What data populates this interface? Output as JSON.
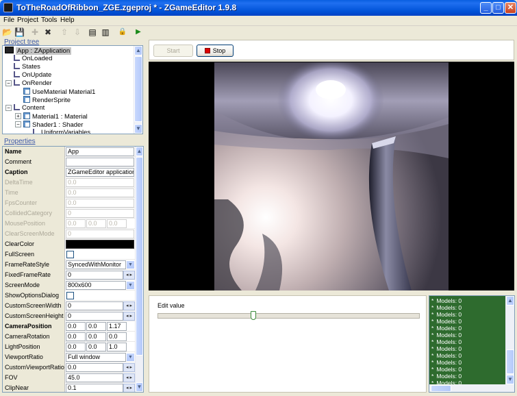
{
  "window": {
    "title": "ToTheRoadOfRibbon_ZGE.zgeproj * - ZGameEditor 1.9.8",
    "minimize": "_",
    "maximize": "□",
    "close": "✕"
  },
  "menu": [
    "File",
    "Project",
    "Tools",
    "Help"
  ],
  "toolbar": [
    {
      "icon": "open-folder-icon",
      "glyph": "📂"
    },
    {
      "icon": "save-icon",
      "glyph": "💾"
    },
    {
      "icon": "add-icon",
      "glyph": "✚"
    },
    {
      "icon": "delete-icon",
      "glyph": "✖"
    },
    {
      "icon": "move-up-icon",
      "glyph": "⇧"
    },
    {
      "icon": "move-down-icon",
      "glyph": "⇩"
    },
    {
      "icon": "copy-icon",
      "glyph": "▤"
    },
    {
      "icon": "paste-icon",
      "glyph": "▥"
    },
    {
      "icon": "lock-icon",
      "glyph": "🔒"
    },
    {
      "icon": "run-icon",
      "glyph": "▶"
    }
  ],
  "project_tree": {
    "label": "Project tree",
    "items": [
      {
        "text": "App : ZApplication",
        "type": "app",
        "selected": true
      },
      {
        "text": "OnLoaded",
        "type": "event"
      },
      {
        "text": "States",
        "type": "event"
      },
      {
        "text": "OnUpdate",
        "type": "event"
      },
      {
        "text": "OnRender",
        "type": "event",
        "expander": "−"
      },
      {
        "text": "UseMaterial  Material1",
        "type": "component"
      },
      {
        "text": "RenderSprite",
        "type": "component"
      },
      {
        "text": "Content",
        "type": "event",
        "expander": "−"
      },
      {
        "text": "Material1 : Material",
        "type": "component",
        "expander": "+"
      },
      {
        "text": "Shader1 : Shader",
        "type": "component",
        "expander": "−"
      },
      {
        "text": "UniformVariables",
        "type": "event"
      }
    ]
  },
  "properties": {
    "label": "Properties",
    "rows": [
      {
        "name": "Name",
        "bold": true,
        "kind": "text",
        "value": "App"
      },
      {
        "name": "Comment",
        "kind": "text",
        "value": ""
      },
      {
        "name": "Caption",
        "bold": true,
        "kind": "text",
        "value": "ZGameEditor application"
      },
      {
        "name": "DeltaTime",
        "disabled": true,
        "kind": "text",
        "value": "0.0"
      },
      {
        "name": "Time",
        "disabled": true,
        "kind": "text",
        "value": "0.0"
      },
      {
        "name": "FpsCounter",
        "disabled": true,
        "kind": "text",
        "value": "0.0"
      },
      {
        "name": "CollidedCategory",
        "disabled": true,
        "kind": "text",
        "value": "0"
      },
      {
        "name": "MousePosition",
        "disabled": true,
        "kind": "vec",
        "values": [
          "0.0",
          "0.0",
          "0.0"
        ]
      },
      {
        "name": "ClearScreenMode",
        "disabled": true,
        "kind": "text",
        "value": "0"
      },
      {
        "name": "ClearColor",
        "kind": "color",
        "value": "#000000"
      },
      {
        "name": "FullScreen",
        "kind": "check",
        "value": ""
      },
      {
        "name": "FrameRateStyle",
        "kind": "select",
        "value": "SyncedWithMonitor"
      },
      {
        "name": "FixedFrameRate",
        "kind": "spin",
        "value": "0"
      },
      {
        "name": "ScreenMode",
        "kind": "select",
        "value": "800x600"
      },
      {
        "name": "ShowOptionsDialog",
        "kind": "check",
        "value": ""
      },
      {
        "name": "CustomScreenWidth",
        "kind": "spin",
        "value": "0"
      },
      {
        "name": "CustomScreenHeight",
        "kind": "spin",
        "value": "0"
      },
      {
        "name": "CameraPosition",
        "bold": true,
        "kind": "vec",
        "values": [
          "0.0",
          "0.0",
          "1.17"
        ]
      },
      {
        "name": "CameraRotation",
        "kind": "vec",
        "values": [
          "0.0",
          "0.0",
          "0.0"
        ]
      },
      {
        "name": "LightPosition",
        "kind": "vec",
        "values": [
          "0.0",
          "0.0",
          "1.0"
        ]
      },
      {
        "name": "ViewportRatio",
        "kind": "select",
        "value": "Full window"
      },
      {
        "name": "CustomViewportRatio",
        "kind": "spin",
        "value": "0.0"
      },
      {
        "name": "FOV",
        "kind": "spin",
        "value": "45.0"
      },
      {
        "name": "ClipNear",
        "kind": "spin",
        "value": "0.1"
      }
    ]
  },
  "preview": {
    "start_label": "Start",
    "stop_label": "Stop"
  },
  "edit_value": {
    "label": "Edit value",
    "slider_level": 0.36
  },
  "log": {
    "lines": [
      "Models: 0",
      "Models: 0",
      "Models: 0",
      "Models: 0",
      "Models: 0",
      "Models: 0",
      "Models: 0",
      "Models: 0",
      "Models: 0",
      "Models: 0",
      "Models: 0",
      "Models: 0",
      "Models: 0"
    ],
    "prefix": "*"
  },
  "colors": {
    "titlebar": "#0153d8",
    "log_background": "#2e6b2e",
    "stop_red": "#dd0000",
    "chrome": "#ece9d8"
  }
}
